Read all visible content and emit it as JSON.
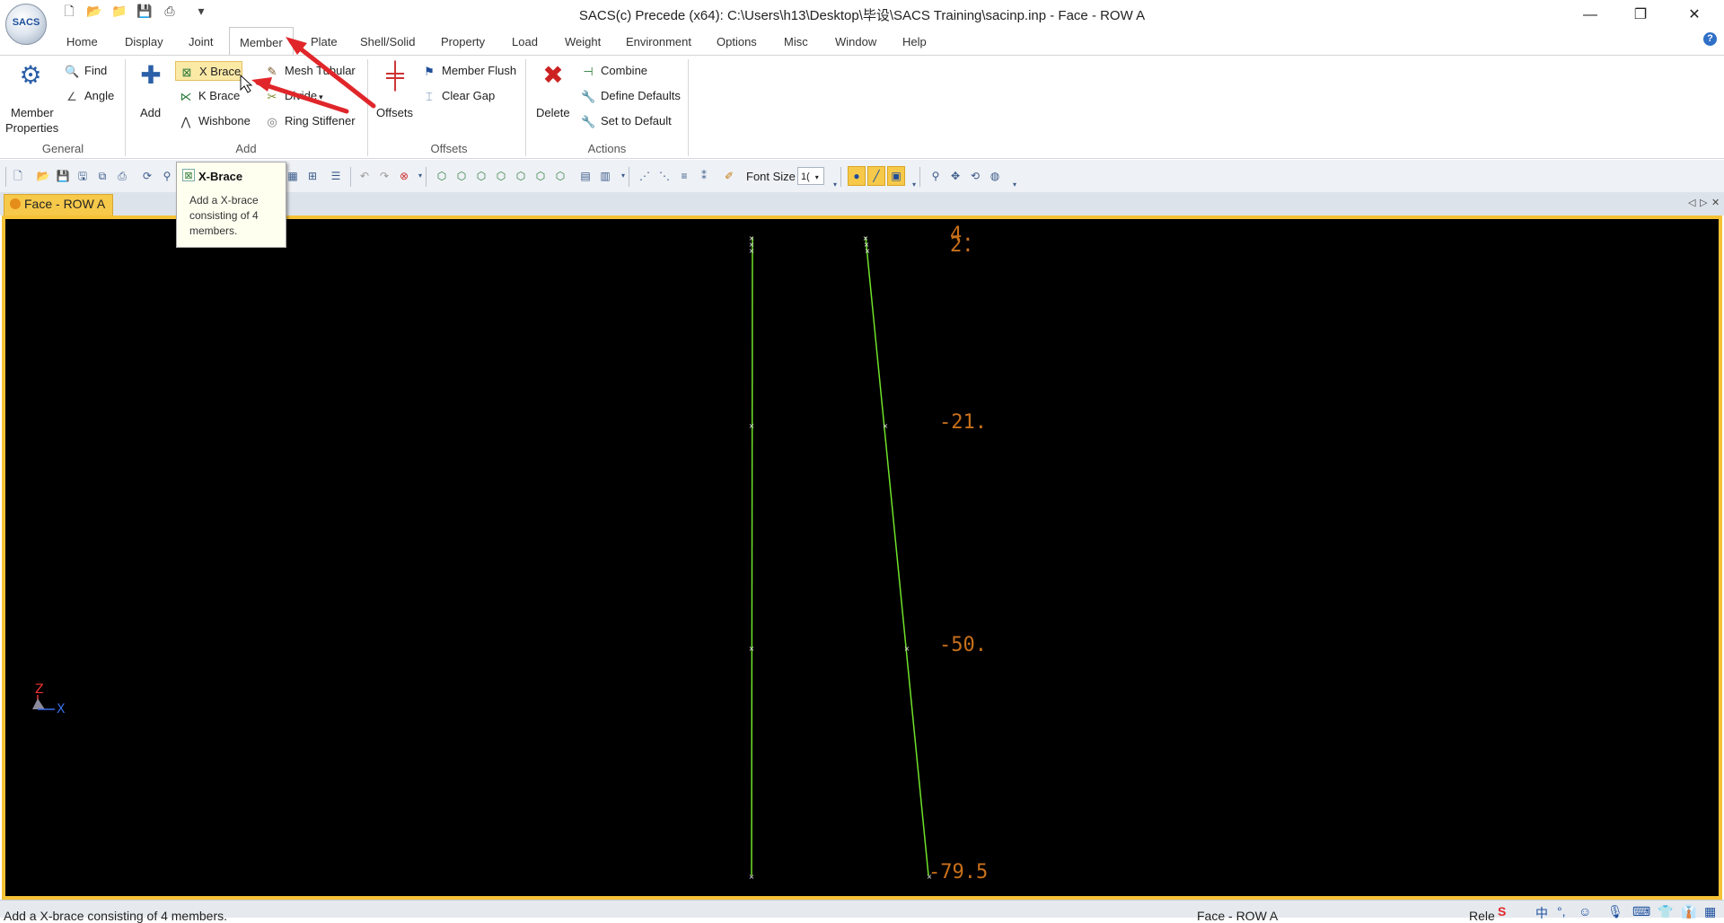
{
  "app": {
    "logo_text": "SACS",
    "title": "SACS(c) Precede (x64): C:\\Users\\h13\\Desktop\\毕设\\SACS Training\\sacinp.inp - Face - ROW A",
    "window_controls": [
      "minimize-icon",
      "restore-icon",
      "close-icon"
    ],
    "quick_access": [
      "new-file-icon",
      "open-folder-icon",
      "open-icon",
      "save-icon",
      "print-icon",
      "customize-dropdown-icon"
    ]
  },
  "ribbon_tabs": [
    "Home",
    "Display",
    "Joint",
    "Member",
    "Plate",
    "Shell/Solid",
    "Property",
    "Load",
    "Weight",
    "Environment",
    "Options",
    "Misc",
    "Window",
    "Help"
  ],
  "active_tab": "Member",
  "groups": {
    "general": {
      "label": "General",
      "member_properties_1": "Member",
      "member_properties_2": "Properties",
      "find": "Find",
      "angle": "Angle"
    },
    "add": {
      "label": "Add",
      "add": "Add",
      "x_brace": "X Brace",
      "k_brace": "K Brace",
      "wishbone": "Wishbone",
      "mesh_tubular": "Mesh Tubular",
      "divide": "Divide",
      "ring_stiffener": "Ring Stiffener"
    },
    "offsets": {
      "label": "Offsets",
      "offsets": "Offsets",
      "member_flush": "Member Flush",
      "clear_gap": "Clear Gap"
    },
    "actions": {
      "label": "Actions",
      "delete": "Delete",
      "combine": "Combine",
      "define_defaults": "Define Defaults",
      "set_to_default": "Set to Default"
    }
  },
  "toolbar": {
    "font_size_label": "Font Size",
    "font_size_value": "1("
  },
  "tooltip": {
    "title": "X-Brace",
    "body": "Add a X-brace consisting of 4 members."
  },
  "document": {
    "tab_label": "Face - ROW A"
  },
  "viewport": {
    "background": "#000000",
    "member_color": "#6fe22a",
    "label_color": "#c8701a",
    "elevation_labels": [
      "4.",
      "2.",
      "-21.",
      "-50.",
      "-79.5"
    ],
    "axis_z": "Z",
    "axis_x": "X"
  },
  "status": {
    "left": "Add a X-brace consisting of 4 members.",
    "middle": "Face - ROW A",
    "right": "Rele"
  }
}
